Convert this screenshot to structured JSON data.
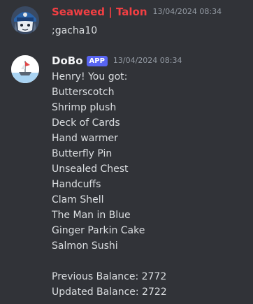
{
  "messages": [
    {
      "author": "Seaweed | Talon",
      "author_color": "#f23f43",
      "timestamp": "13/04/2024 08:34",
      "lines": [
        ";gacha10"
      ],
      "avatar_icon": "character-avatar"
    },
    {
      "author": "DoBo",
      "author_color": "#f2f3f5",
      "app_tag": "APP",
      "timestamp": "13/04/2024 08:34",
      "avatar_icon": "boat-avatar",
      "intro": "Henry! You got:",
      "items": [
        "Butterscotch",
        "Shrimp plush",
        "Deck of Cards",
        "Hand warmer",
        "Butterfly Pin",
        "Unsealed Chest",
        "Handcuffs",
        "Clam Shell",
        "The Man in Blue",
        "Ginger Parkin Cake",
        "Salmon Sushi"
      ],
      "previous_balance": "Previous Balance: 2772",
      "updated_balance": "Updated Balance: 2722"
    }
  ],
  "colors": {
    "background": "#313338",
    "text": "#dbdee1",
    "timestamp": "#949ba4",
    "app_tag": "#5865f2"
  }
}
